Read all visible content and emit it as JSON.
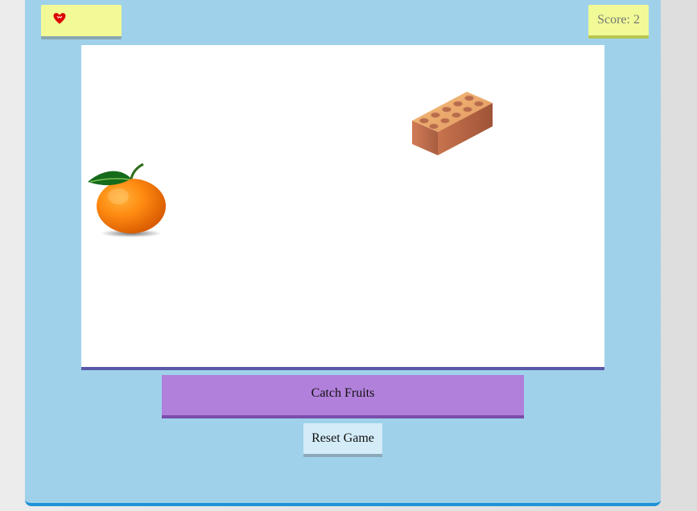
{
  "game": {
    "title": "Catch Fruits",
    "score_text": "Score: 2",
    "score_value": 2,
    "lives_icon": "heart-icon",
    "reset_label": "Reset Game"
  },
  "objects": [
    {
      "type": "orange",
      "icon": "orange-icon"
    },
    {
      "type": "brick",
      "icon": "brick-icon"
    }
  ],
  "colors": {
    "panel": "#9fd2ea",
    "panel_border": "#1e93d6",
    "yellow_box": "#f1fa96",
    "game_area": "#ffffff",
    "purple_button": "#b180da",
    "reset_button": "#d3ecf8",
    "heart": "#e00000"
  }
}
